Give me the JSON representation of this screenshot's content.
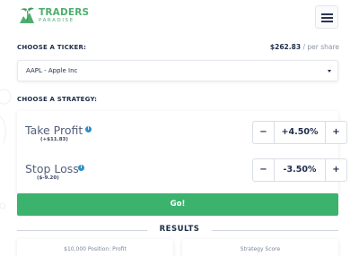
{
  "brand": {
    "line1": "TRADERS",
    "line2": "PARADISE",
    "color": "#4fae6f"
  },
  "header": {
    "menu_icon": "hamburger-menu-icon"
  },
  "ticker": {
    "section_label": "CHOOSE A TICKER:",
    "price": "$262.83",
    "price_unit": "/ per share",
    "selected": "AAPL - Apple Inc",
    "caret_icon": "caret-down-icon"
  },
  "strategy": {
    "section_label": "CHOOSE A STRATEGY:",
    "take_profit": {
      "label": "Take Profit",
      "sub": "(+$11.83)",
      "value": "+4.50%",
      "minus": "−",
      "plus": "+"
    },
    "stop_loss": {
      "label": "Stop Loss",
      "sub": "($-9.20)",
      "value": "-3.50%",
      "minus": "−",
      "plus": "+"
    },
    "info_icon": "info-icon"
  },
  "go_button": {
    "label": "Go!",
    "color": "#3bb36d"
  },
  "results": {
    "title": "RESULTS",
    "cards": [
      {
        "label": "$10,000 Position: Profit"
      },
      {
        "label": "Strategy Score"
      }
    ]
  }
}
